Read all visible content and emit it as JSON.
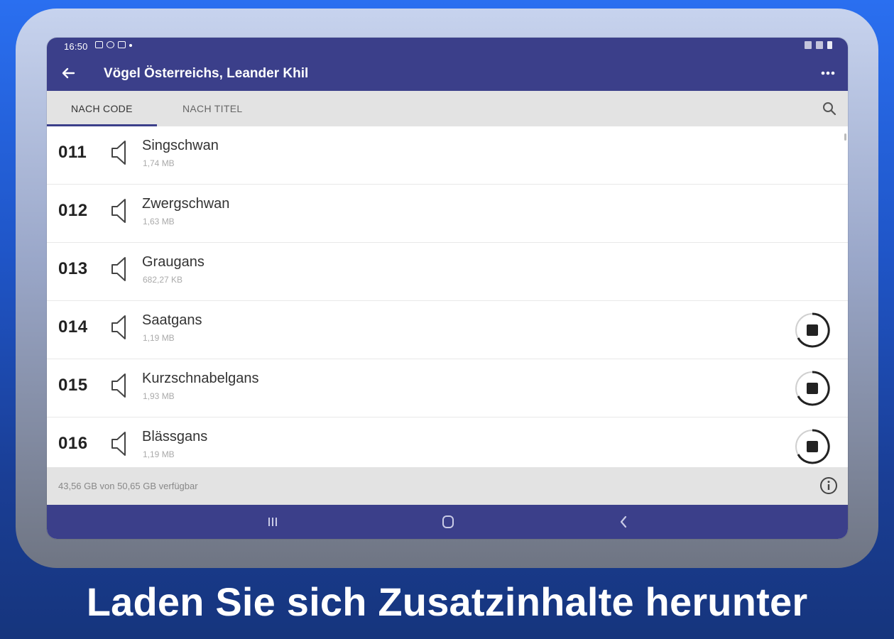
{
  "status": {
    "time": "16:50"
  },
  "appbar": {
    "title": "Vögel Österreichs, Leander Khil",
    "back_icon": "arrow-left-icon",
    "more_icon": "more-horizontal-icon"
  },
  "tabs": [
    {
      "label": "NACH CODE",
      "active": true
    },
    {
      "label": "NACH TITEL",
      "active": false
    }
  ],
  "items": [
    {
      "code": "011",
      "name": "Singschwan",
      "size": "1,74 MB",
      "downloading": false
    },
    {
      "code": "012",
      "name": "Zwergschwan",
      "size": "1,63 MB",
      "downloading": false
    },
    {
      "code": "013",
      "name": "Graugans",
      "size": "682,27 KB",
      "downloading": false
    },
    {
      "code": "014",
      "name": "Saatgans",
      "size": "1,19 MB",
      "downloading": true
    },
    {
      "code": "015",
      "name": "Kurzschnabelgans",
      "size": "1,93 MB",
      "downloading": true
    },
    {
      "code": "016",
      "name": "Blässgans",
      "size": "1,19 MB",
      "downloading": true
    }
  ],
  "footer": {
    "storage": "43,56 GB von 50,65 GB verfügbar"
  },
  "caption": "Laden Sie sich Zusatzinhalte herunter",
  "colors": {
    "primary": "#3b3f8a",
    "tabbar": "#e3e3e3"
  }
}
